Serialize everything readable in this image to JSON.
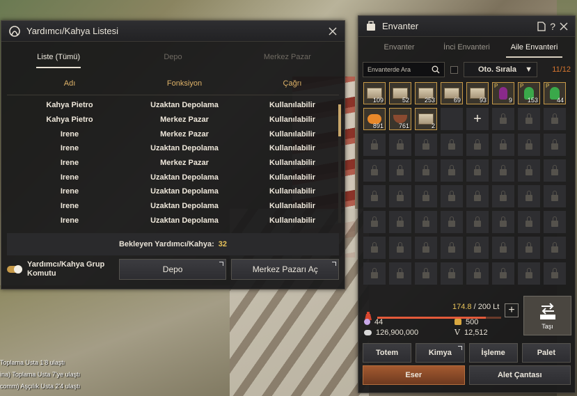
{
  "background": {
    "chat_lines": [
      "Toplama Usta 1'8 ulaştı",
      "ina) Toplama Usta 7'ye ulaştı",
      "comm) Aşçılık Usta 2'4 ulaştı"
    ]
  },
  "servant_window": {
    "title": "Yardımcı/Kahya Listesi",
    "tabs": [
      "Liste (Tümü)",
      "Depo",
      "Merkez Pazar"
    ],
    "columns": [
      "Adı",
      "Fonksiyon",
      "Çağrı"
    ],
    "rows": [
      {
        "name": "Kahya Pietro",
        "function": "Uzaktan Depolama",
        "call": "Kullanılabilir"
      },
      {
        "name": "Kahya Pietro",
        "function": "Merkez Pazar",
        "call": "Kullanılabilir"
      },
      {
        "name": "Irene",
        "function": "Merkez Pazar",
        "call": "Kullanılabilir"
      },
      {
        "name": "Irene",
        "function": "Uzaktan Depolama",
        "call": "Kullanılabilir"
      },
      {
        "name": "Irene",
        "function": "Merkez Pazar",
        "call": "Kullanılabilir"
      },
      {
        "name": "Irene",
        "function": "Uzaktan Depolama",
        "call": "Kullanılabilir"
      },
      {
        "name": "Irene",
        "function": "Uzaktan Depolama",
        "call": "Kullanılabilir"
      },
      {
        "name": "Irene",
        "function": "Uzaktan Depolama",
        "call": "Kullanılabilir"
      },
      {
        "name": "Irene",
        "function": "Uzaktan Depolama",
        "call": "Kullanılabilir"
      }
    ],
    "waiting_label": "Bekleyen Yardımcı/Kahya:",
    "waiting_count": "32",
    "group_command_label": "Yardımcı/Kahya Grup Komutu",
    "depot_button": "Depo",
    "market_button": "Merkez Pazarı Aç",
    "scroll_fraction": 0.27
  },
  "inventory_window": {
    "title": "Envanter",
    "tabs": [
      "Envanter",
      "İnci Envanteri",
      "Aile Envanteri"
    ],
    "search_placeholder": "Envanterde Ara",
    "sort_label": "Oto. Sırala",
    "slot_count": "11/12",
    "items": [
      {
        "icon": "scroll-icon",
        "qty": "109"
      },
      {
        "icon": "scroll-icon",
        "qty": "52"
      },
      {
        "icon": "scroll-icon",
        "qty": "253"
      },
      {
        "icon": "scroll-icon",
        "qty": "69"
      },
      {
        "icon": "scroll-icon",
        "qty": "93"
      },
      {
        "icon": "potion-purple-icon",
        "qty": "9",
        "prefix": "P"
      },
      {
        "icon": "potion-green-icon",
        "qty": "153",
        "prefix": "P"
      },
      {
        "icon": "potion-green-icon",
        "qty": "44",
        "prefix": "P"
      },
      {
        "icon": "orange-fruit-icon",
        "qty": "891"
      },
      {
        "icon": "bowl-icon",
        "qty": "761"
      },
      {
        "icon": "scroll-icon",
        "qty": "2"
      }
    ],
    "weight_current": "174.8",
    "weight_sep": " / ",
    "weight_max": "200 Lt",
    "weight_fraction": 0.874,
    "move_label": "Taşı",
    "pearls": "44",
    "silver": "126,900,000",
    "energy": "500",
    "value_points": "12,512",
    "buttons_row1": [
      "Totem",
      "Kimya",
      "İşleme",
      "Palet"
    ],
    "buttons_row2": [
      "Eser",
      "Alet Çantası"
    ],
    "colors": {
      "accent": "#e8c35a",
      "border_gold": "#c79a48",
      "orange": "#a45a30"
    }
  }
}
